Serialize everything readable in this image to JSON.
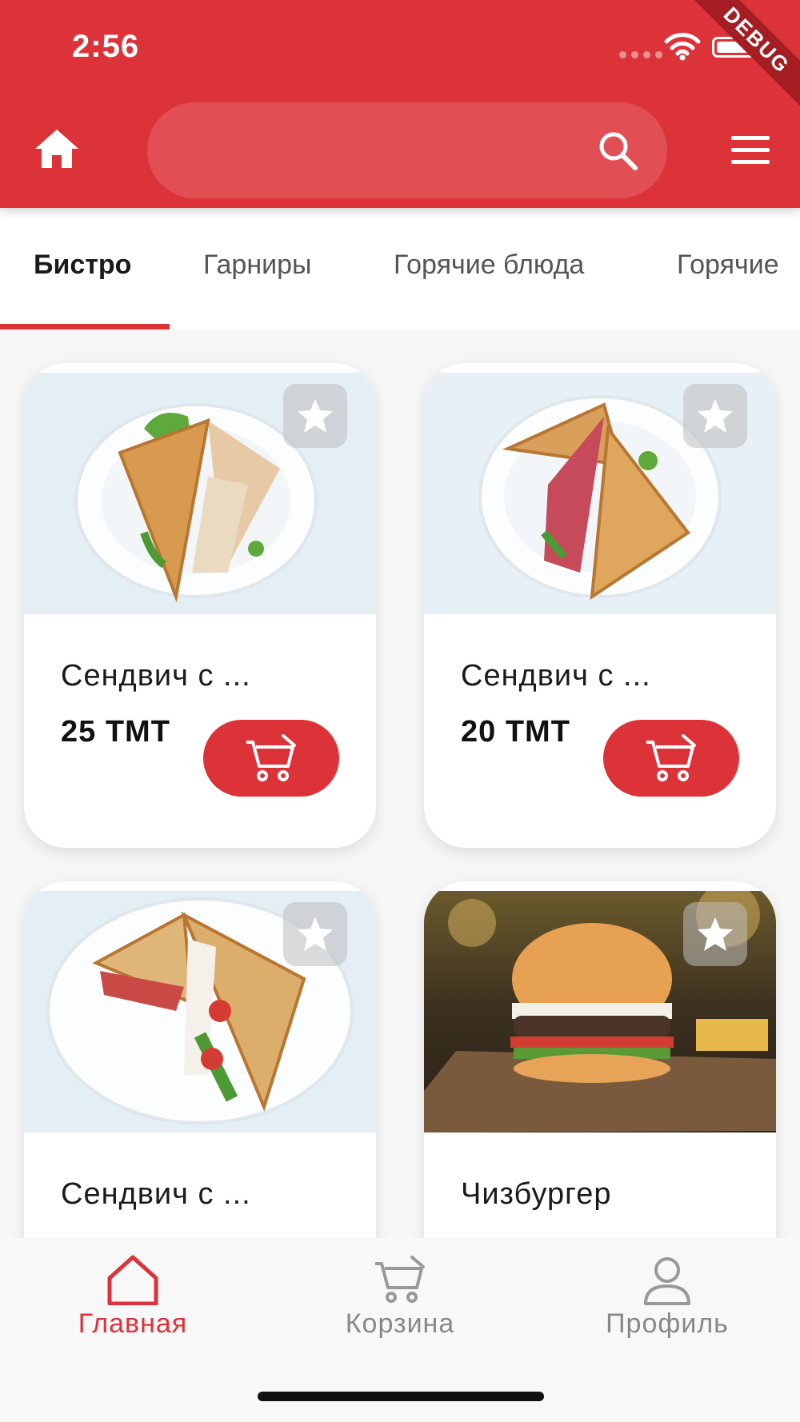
{
  "status_bar": {
    "time": "2:56",
    "debug_label": "DEBUG"
  },
  "header": {
    "home_icon": "home-icon",
    "search_placeholder": "",
    "search_icon": "search-icon",
    "menu_icon": "menu-icon"
  },
  "tabs": [
    {
      "label": "Бистро",
      "active": true
    },
    {
      "label": "Гарниры",
      "active": false
    },
    {
      "label": "Горячие блюда",
      "active": false
    },
    {
      "label": "Горячие",
      "active": false
    }
  ],
  "products": [
    {
      "name": "Сендвич с ...",
      "price": "25 TMT",
      "image": "sandwich-chicken"
    },
    {
      "name": "Сендвич с ...",
      "price": "20 TMT",
      "image": "sandwich-sausage"
    },
    {
      "name": "Сендвич с ...",
      "price": "",
      "image": "sandwich-vegetable"
    },
    {
      "name": "Чизбургер",
      "price": "",
      "image": "cheeseburger"
    }
  ],
  "bottom_nav": [
    {
      "label": "Главная",
      "icon": "home-outline-icon",
      "active": true
    },
    {
      "label": "Корзина",
      "icon": "cart-icon",
      "active": false
    },
    {
      "label": "Профиль",
      "icon": "profile-icon",
      "active": false
    }
  ],
  "colors": {
    "primary": "#dc3338",
    "background": "#f6f6f6",
    "inactive": "#888888"
  }
}
